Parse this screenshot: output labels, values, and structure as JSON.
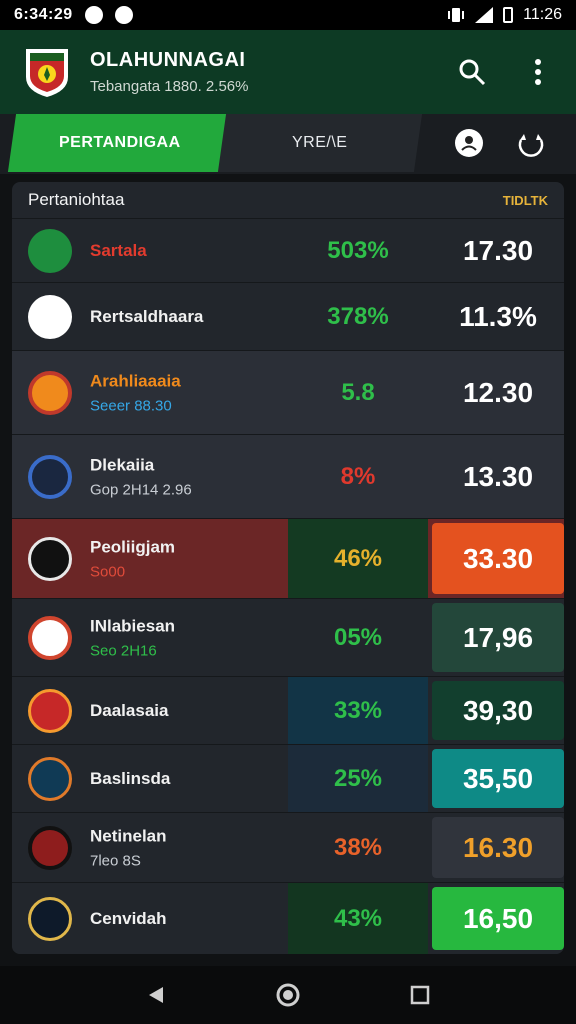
{
  "status_bar": {
    "time": "6:34:29",
    "right_time": "11:26"
  },
  "app_bar": {
    "title": "OLAHUNNAGAI",
    "subtitle": "Tebangata 1880. 2.56%"
  },
  "tabs": [
    {
      "label": "PERTANDIGAA",
      "active": true
    },
    {
      "label": "YRE/\\E",
      "active": false
    }
  ],
  "card": {
    "header_left": "Pertaniohtaa",
    "header_right": "TIDLTK",
    "rows": [
      {
        "team": "Sartala",
        "meta": "",
        "pct": "503%",
        "odds": "17.30",
        "team_color": "#e23b2e",
        "meta_color": "#b8bec5",
        "pct_color": "#2fbf4a",
        "row_bg": "#22262c",
        "pct_bg": "transparent",
        "odds_bg": "transparent"
      },
      {
        "team": "Rertsaldhaara",
        "meta": "",
        "pct": "378%",
        "odds": "11.3%",
        "team_color": "#f1f1f1",
        "meta_color": "#b8bec5",
        "pct_color": "#2fbf4a",
        "row_bg": "#22262c",
        "pct_bg": "transparent",
        "odds_bg": "transparent"
      },
      {
        "team": "Arahliaaaia",
        "meta": "Seeer 88.30",
        "pct": "5.8",
        "odds": "12.30",
        "team_color": "#f08a1c",
        "meta_color": "#35a7e6",
        "pct_color": "#2fbf4a",
        "row_bg": "#2b2f37",
        "pct_bg": "transparent",
        "odds_bg": "transparent"
      },
      {
        "team": "Dlekaiia",
        "meta": "Gop 2H14 2.96",
        "pct": "8%",
        "odds": "13.30",
        "team_color": "#f1f1f1",
        "meta_color": "#c9ced4",
        "pct_color": "#e0392d",
        "row_bg": "#2b2f37",
        "pct_bg": "transparent",
        "odds_bg": "transparent"
      },
      {
        "team": "Peoliigjam",
        "meta": "So00",
        "pct": "46%",
        "odds": "33.30",
        "team_color": "#f1f1f1",
        "meta_color": "#e04b3a",
        "pct_color": "#e6b12c",
        "row_bg": "#6b2626",
        "pct_bg": "#143a22",
        "odds_bg": "#e4521f"
      },
      {
        "team": "INlabiesan",
        "meta": "Seo 2H16",
        "pct": "05%",
        "odds": "17,96",
        "team_color": "#f1f1f1",
        "meta_color": "#2fbf4a",
        "pct_color": "#2fbf4a",
        "row_bg": "#22262c",
        "pct_bg": "transparent",
        "odds_bg": "#23473a"
      },
      {
        "team": "Daalasaia",
        "meta": "",
        "pct": "33%",
        "odds": "39,30",
        "team_color": "#f1f1f1",
        "meta_color": "#b8bec5",
        "pct_color": "#2fbf4a",
        "row_bg": "#22262c",
        "pct_bg": "#123446",
        "odds_bg": "#123f2e"
      },
      {
        "team": "Baslinsda",
        "meta": "",
        "pct": "25%",
        "odds": "35,50",
        "team_color": "#f1f1f1",
        "meta_color": "#b8bec5",
        "pct_color": "#2fbf4a",
        "row_bg": "#22262c",
        "pct_bg": "#1c2b3a",
        "odds_bg": "#0e8a86"
      },
      {
        "team": "Netinelan",
        "meta": "7leo 8S",
        "pct": "38%",
        "odds": "16.30",
        "team_color": "#f1f1f1",
        "meta_color": "#c9ced4",
        "pct_color": "#e8622a",
        "row_bg": "#22262c",
        "pct_bg": "transparent",
        "odds_bg": "#30343c"
      },
      {
        "team": "Cenvidah",
        "meta": "",
        "pct": "43%",
        "odds": "16,50",
        "team_color": "#f1f1f1",
        "meta_color": "#b8bec5",
        "pct_color": "#2fbf4a",
        "row_bg": "#22262c",
        "pct_bg": "#133620",
        "odds_bg": "#27b83f"
      }
    ]
  }
}
